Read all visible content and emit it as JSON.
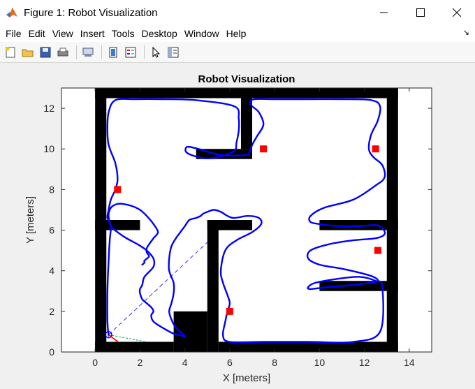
{
  "window": {
    "title": "Figure 1: Robot Visualization"
  },
  "menu": [
    "File",
    "Edit",
    "View",
    "Insert",
    "Tools",
    "Desktop",
    "Window",
    "Help"
  ],
  "toolbar": {
    "icons": [
      "new-figure-icon",
      "open-file-icon",
      "save-icon",
      "print-icon",
      "link-plot-icon",
      "colorbar-icon",
      "legend-icon",
      "pointer-icon",
      "property-inspector-icon"
    ]
  },
  "chart_data": {
    "type": "line",
    "title": "Robot Visualization",
    "xlabel": "X [meters]",
    "ylabel": "Y [meters]",
    "xlim": [
      -1.5,
      15
    ],
    "ylim": [
      0,
      13
    ],
    "xticks": [
      0,
      2,
      4,
      6,
      8,
      10,
      12,
      14
    ],
    "yticks": [
      0,
      2,
      4,
      6,
      8,
      10,
      12
    ],
    "grid": false,
    "map_walls": [
      {
        "x0": 0.0,
        "y0": 12.5,
        "x1": 13.5,
        "y1": 13.0
      },
      {
        "x0": 0.0,
        "y0": 0.0,
        "x1": 0.5,
        "y1": 13.0
      },
      {
        "x0": 13.0,
        "y0": 0.0,
        "x1": 13.5,
        "y1": 13.0
      },
      {
        "x0": 0.0,
        "y0": 0.0,
        "x1": 3.5,
        "y1": 0.5
      },
      {
        "x0": 5.5,
        "y0": 0.0,
        "x1": 13.5,
        "y1": 0.5
      },
      {
        "x0": 3.5,
        "y0": 0.0,
        "x1": 5.0,
        "y1": 2.0
      },
      {
        "x0": 5.0,
        "y0": 0.0,
        "x1": 5.5,
        "y1": 6.5
      },
      {
        "x0": 5.0,
        "y0": 6.0,
        "x1": 7.0,
        "y1": 6.5
      },
      {
        "x0": 0.0,
        "y0": 6.0,
        "x1": 2.0,
        "y1": 6.5
      },
      {
        "x0": 6.5,
        "y0": 10.0,
        "x1": 7.0,
        "y1": 13.0
      },
      {
        "x0": 4.5,
        "y0": 9.5,
        "x1": 7.0,
        "y1": 10.0
      },
      {
        "x0": 10.0,
        "y0": 6.0,
        "x1": 13.5,
        "y1": 6.5
      },
      {
        "x0": 10.0,
        "y0": 3.0,
        "x1": 13.5,
        "y1": 3.5
      }
    ],
    "series": [
      {
        "color": "#0000ff",
        "x": [
          0.6,
          0.55,
          0.55,
          0.6,
          0.65,
          0.7,
          0.55,
          0.6,
          0.7,
          0.9,
          1.0,
          0.9,
          0.6,
          0.55,
          0.6,
          0.9,
          1.8,
          3.0,
          4.5,
          6.2,
          6.4,
          6.4,
          6.3,
          6.2,
          5.5,
          4.8,
          4.1,
          4.1,
          4.6,
          5.6,
          6.7,
          6.9,
          7.0,
          7.2,
          7.5,
          7.3,
          7.0,
          6.9,
          7.1,
          8.0,
          9.5,
          11.0,
          12.3,
          12.7,
          12.6,
          12.3,
          12.2,
          12.4,
          12.8,
          12.9,
          12.5,
          11.5,
          10.2,
          9.6,
          9.6,
          10.0,
          10.8,
          11.8,
          12.5,
          12.8,
          12.9,
          12.5,
          11.5,
          10.4,
          9.6,
          9.5,
          10.0,
          11.0,
          11.8,
          12.4,
          12.6,
          12.2,
          11.5,
          10.4,
          9.6,
          9.5,
          9.8,
          10.8,
          11.8,
          12.5,
          12.8,
          12.7,
          11.5,
          9.5,
          7.5,
          6.0,
          5.7,
          5.8,
          5.9,
          6.0,
          5.9,
          5.7,
          5.6,
          5.8,
          6.3,
          7.0,
          7.4,
          7.3,
          6.8,
          6.2,
          5.9,
          5.6,
          5.3,
          5.0,
          4.8,
          4.7,
          4.5,
          4.2,
          4.0,
          3.8,
          3.6,
          3.4,
          3.3,
          3.3,
          3.5,
          3.5,
          3.4,
          3.3,
          3.4,
          3.6,
          3.9,
          4.0,
          3.9,
          3.5,
          3.0,
          2.6,
          2.5,
          2.6,
          2.5,
          2.3,
          2.1,
          2.0,
          2.0,
          2.1,
          2.2,
          2.6,
          2.6,
          2.3,
          1.9,
          1.4,
          1.0,
          0.7,
          0.6,
          0.65,
          0.8,
          1.1,
          1.6,
          2.0,
          2.3,
          2.6,
          2.8,
          2.6,
          2.4,
          2.3,
          2.3,
          2.4,
          2.2,
          2.2,
          2.1
        ],
        "y": [
          0.8,
          1.5,
          3.0,
          4.5,
          5.5,
          6.2,
          6.6,
          7.0,
          7.5,
          8.0,
          8.5,
          9.3,
          10.2,
          11.0,
          11.8,
          12.4,
          12.45,
          12.45,
          12.4,
          12.1,
          11.5,
          10.9,
          10.3,
          9.9,
          9.6,
          9.55,
          9.8,
          10.1,
          10.0,
          9.7,
          9.7,
          9.9,
          10.2,
          10.6,
          11.2,
          11.8,
          12.1,
          12.3,
          12.45,
          12.45,
          12.45,
          12.45,
          12.4,
          12.1,
          11.4,
          10.7,
          10.0,
          9.6,
          9.2,
          8.6,
          8.2,
          7.5,
          7.1,
          6.7,
          6.4,
          6.3,
          6.2,
          6.2,
          6.25,
          6.1,
          5.8,
          5.6,
          5.5,
          5.3,
          5.0,
          4.6,
          4.3,
          4.1,
          3.9,
          3.7,
          3.5,
          3.4,
          3.3,
          3.2,
          3.1,
          3.2,
          3.4,
          3.6,
          3.7,
          3.5,
          3.2,
          1.0,
          0.5,
          0.5,
          0.5,
          0.5,
          0.8,
          1.5,
          2.0,
          2.4,
          2.8,
          3.4,
          4.0,
          5.0,
          5.5,
          5.9,
          6.3,
          6.6,
          6.7,
          6.6,
          6.7,
          6.9,
          7.0,
          6.9,
          6.8,
          6.7,
          6.6,
          6.5,
          6.2,
          5.9,
          5.6,
          5.2,
          4.6,
          4.0,
          3.4,
          2.9,
          2.4,
          2.0,
          1.6,
          1.2,
          0.9,
          0.75,
          0.8,
          0.9,
          1.2,
          1.5,
          1.8,
          2.0,
          2.2,
          2.4,
          2.6,
          2.9,
          3.1,
          3.3,
          3.7,
          4.2,
          4.6,
          5.0,
          5.3,
          5.6,
          5.9,
          6.2,
          6.7,
          7.0,
          7.2,
          7.3,
          7.2,
          7.0,
          6.7,
          6.3,
          5.9,
          5.6,
          5.3,
          5.1,
          4.9,
          4.7,
          4.5,
          4.4,
          4.3
        ]
      }
    ],
    "waypoints": [
      {
        "x": 1.0,
        "y": 8.0
      },
      {
        "x": 7.5,
        "y": 10.0
      },
      {
        "x": 12.5,
        "y": 10.0
      },
      {
        "x": 12.6,
        "y": 5.0
      },
      {
        "x": 6.0,
        "y": 2.0
      }
    ],
    "robot": {
      "x": 0.6,
      "y": 0.85,
      "heading_deg": -40
    },
    "lookahead": {
      "x0": 0.6,
      "y0": 0.85,
      "x1": 5.0,
      "y1": 5.4
    },
    "sensor_rays": [
      {
        "x1": 2.3,
        "y1": 0.5
      },
      {
        "x1": 2.0,
        "y1": 0.55
      }
    ],
    "colors": {
      "path": "#0000ff",
      "walls": "#000000",
      "waypoint": "#ff0000",
      "robot": "#0000ff",
      "heading": "#ff0000",
      "lookahead": "#0000ff",
      "sensor": "#00b050"
    }
  }
}
